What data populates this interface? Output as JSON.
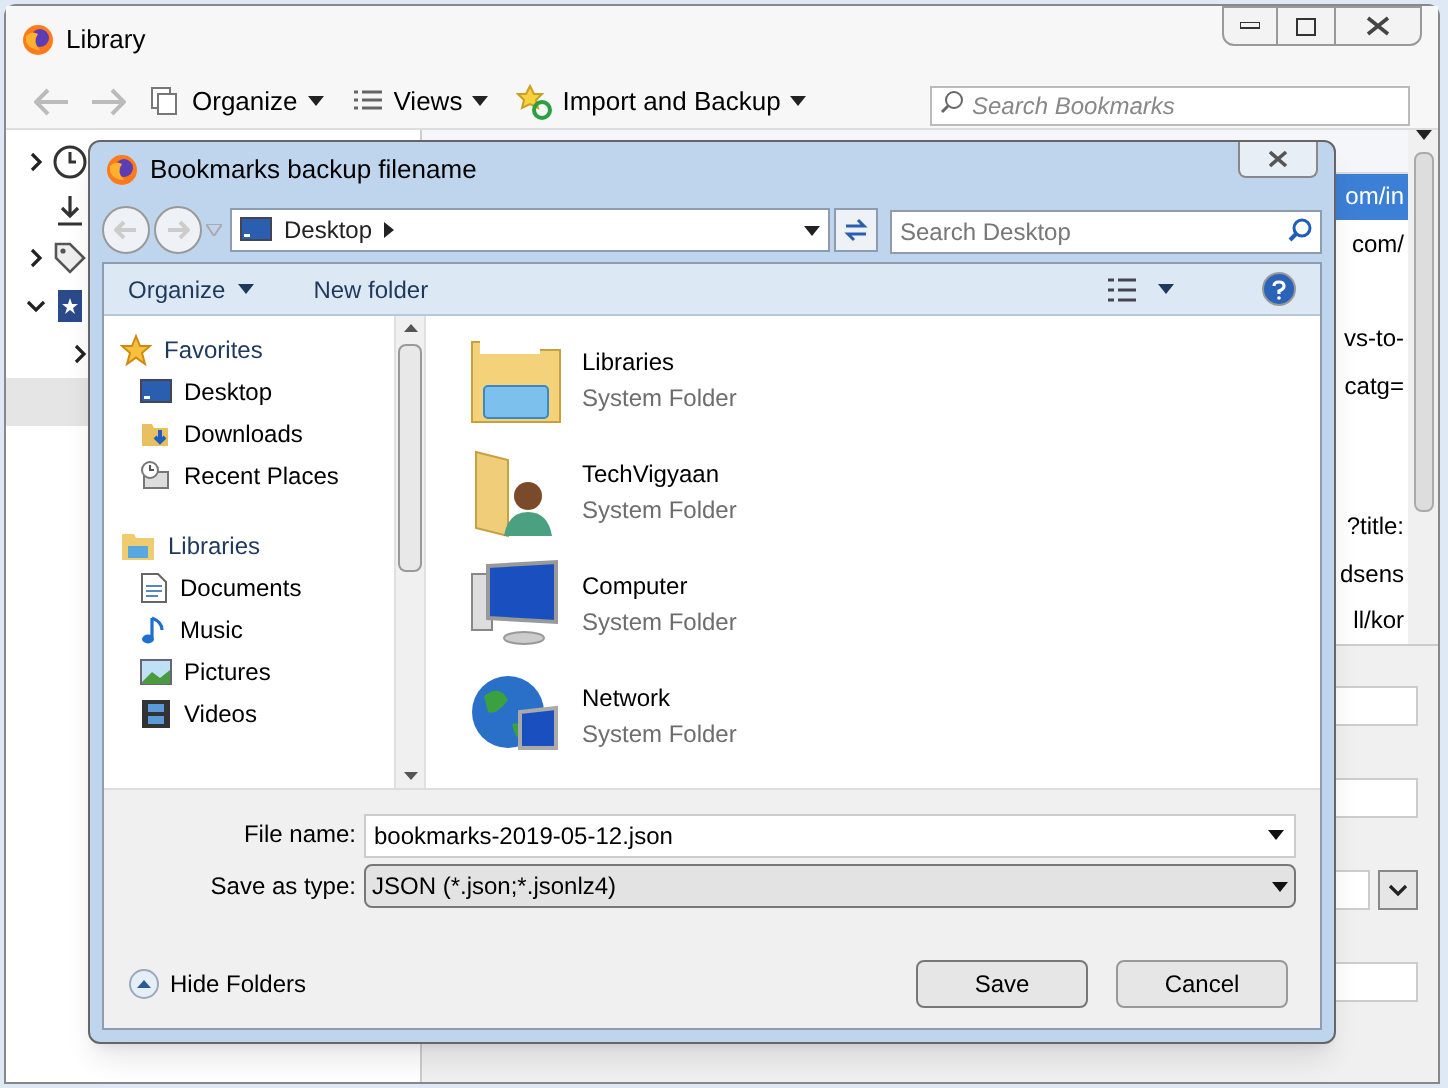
{
  "library": {
    "title": "Library",
    "toolbar": [
      {
        "label": "Organize",
        "kind": "organize"
      },
      {
        "label": "Views",
        "kind": "views"
      },
      {
        "label": "Import and Backup",
        "kind": "import"
      }
    ],
    "search": {
      "placeholder": "Search Bookmarks"
    },
    "tree": [
      {
        "kind": "history",
        "expanded": false
      },
      {
        "kind": "downloads"
      },
      {
        "kind": "tags",
        "expanded": false
      },
      {
        "kind": "bookmarks",
        "expanded": true,
        "children": [
          {
            "expanded": false,
            "selected": false
          },
          {
            "selected": true
          }
        ]
      }
    ],
    "rows": [
      {
        "location": "om/in",
        "selected": true
      },
      {
        "location": "com/",
        "selected": false
      },
      {
        "selected": false
      },
      {
        "location": "vs-to-",
        "selected": false
      },
      {
        "location": "catg=",
        "selected": false
      },
      {
        "selected": false
      },
      {
        "selected": false
      },
      {
        "location": "?title:",
        "selected": false
      },
      {
        "location": "dsens",
        "selected": false
      },
      {
        "location": "ll/kor",
        "selected": false
      }
    ]
  },
  "dialog": {
    "title": "Bookmarks backup filename",
    "path": "Desktop",
    "search": {
      "placeholder": "Search Desktop"
    },
    "commands": [
      {
        "label": "Organize",
        "kind": "menu"
      },
      {
        "label": "New folder",
        "kind": "button"
      }
    ],
    "nav": [
      {
        "label": "Favorites",
        "kind": "star",
        "children": [
          {
            "label": "Desktop",
            "kind": "desktop"
          },
          {
            "label": "Downloads",
            "kind": "downloads"
          },
          {
            "label": "Recent Places",
            "kind": "recent"
          }
        ]
      },
      {
        "label": "Libraries",
        "kind": "libraries",
        "children": [
          {
            "label": "Documents",
            "kind": "documents"
          },
          {
            "label": "Music",
            "kind": "music"
          },
          {
            "label": "Pictures",
            "kind": "pictures"
          },
          {
            "label": "Videos",
            "kind": "videos"
          }
        ]
      }
    ],
    "files": [
      {
        "name": "Libraries",
        "type": "System Folder",
        "kind": "libraries"
      },
      {
        "name": "TechVigyaan",
        "type": "System Folder",
        "kind": "user"
      },
      {
        "name": "Computer",
        "type": "System Folder",
        "kind": "computer"
      },
      {
        "name": "Network",
        "type": "System Folder",
        "kind": "network"
      }
    ],
    "file_name_label": "File name:",
    "file_name": "bookmarks-2019-05-12.json",
    "save_type_label": "Save as type:",
    "save_type": "JSON (*.json;*.jsonlz4)",
    "hide_folders": "Hide Folders",
    "buttons": [
      {
        "label": "Save",
        "kind": "default"
      },
      {
        "label": "Cancel",
        "kind": "cancel"
      }
    ]
  }
}
